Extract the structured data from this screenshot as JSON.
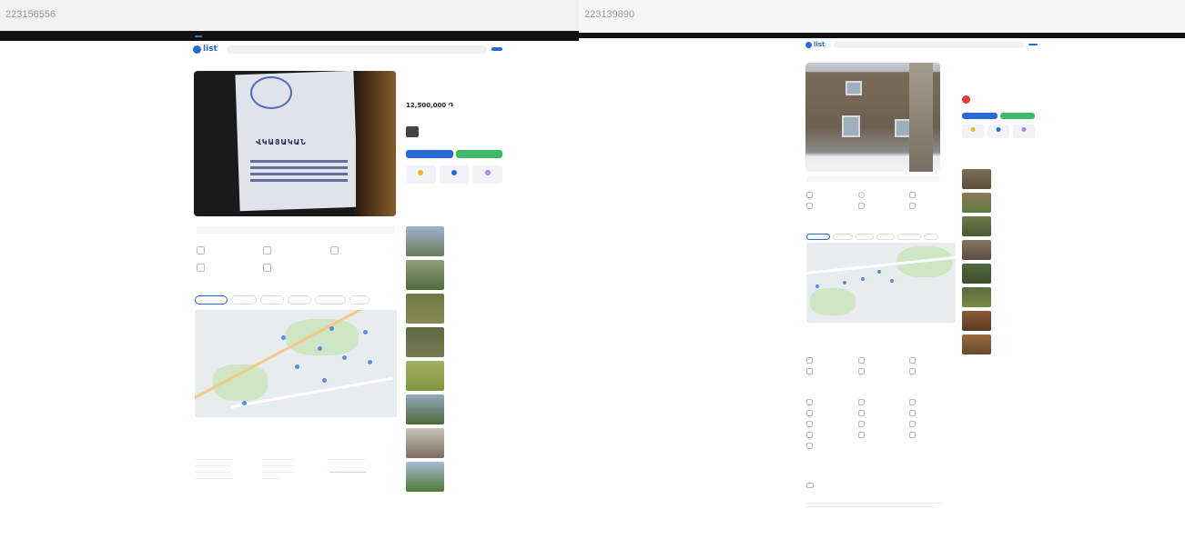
{
  "left": {
    "id_label": "223156556",
    "topnav": {
      "active": "",
      "items": [
        "",
        ""
      ],
      "right": [
        "",
        ""
      ]
    },
    "header": {
      "logo": "list",
      "location": "",
      "search_placeholder": "",
      "post_button": ""
    },
    "listing": {
      "title": "",
      "price": "12,500,000 ֏",
      "doc_text": "ՎԿԱՅԱԿԱՆ",
      "seller": "",
      "call_button": "",
      "message_button": "",
      "map_link": "",
      "features": [
        "",
        "",
        "",
        "",
        ""
      ],
      "location_heading": "",
      "location_sub": "",
      "map_tabs": [
        "",
        "",
        "",
        "",
        "",
        ""
      ],
      "details_heading": "",
      "description_heading": ""
    },
    "similar": {
      "heading": "",
      "items": [
        {
          "price": ""
        },
        {
          "price": ""
        },
        {
          "price": ""
        },
        {
          "price": ""
        },
        {
          "price": ""
        },
        {
          "price": ""
        },
        {
          "price": ""
        },
        {
          "price": ""
        }
      ]
    }
  },
  "right": {
    "id_label": "223139890",
    "topnav": {
      "active": "",
      "items": [
        "",
        ""
      ],
      "right": [
        "",
        ""
      ]
    },
    "header": {
      "logo": "list",
      "location": "",
      "search_placeholder": "",
      "post_button": ""
    },
    "listing": {
      "title": "",
      "price": "",
      "seller": "",
      "call_button": "",
      "message_button": "",
      "map_link": "",
      "features_heading": "",
      "features": [
        "",
        "",
        "",
        "",
        "",
        ""
      ],
      "location_heading": "",
      "location_sub": "",
      "map_tabs": [
        "",
        "",
        "",
        "",
        "",
        ""
      ],
      "amenities_heading": "",
      "amenities": [
        "",
        "",
        "",
        "",
        "",
        ""
      ],
      "utilities_heading": "",
      "utilities": [
        "",
        "",
        "",
        "",
        "",
        "",
        "",
        "",
        "",
        "",
        "",
        "",
        ""
      ],
      "agent_heading": "",
      "description_heading": ""
    },
    "similar": {
      "heading": "",
      "items": [
        {
          "price": ""
        },
        {
          "price": ""
        },
        {
          "price": ""
        },
        {
          "price": ""
        },
        {
          "price": ""
        },
        {
          "price": ""
        },
        {
          "price": ""
        },
        {
          "price": ""
        }
      ]
    }
  },
  "colors": {
    "brand": "#2a6ad8",
    "green": "#3fb96a",
    "nav": "#111111"
  }
}
